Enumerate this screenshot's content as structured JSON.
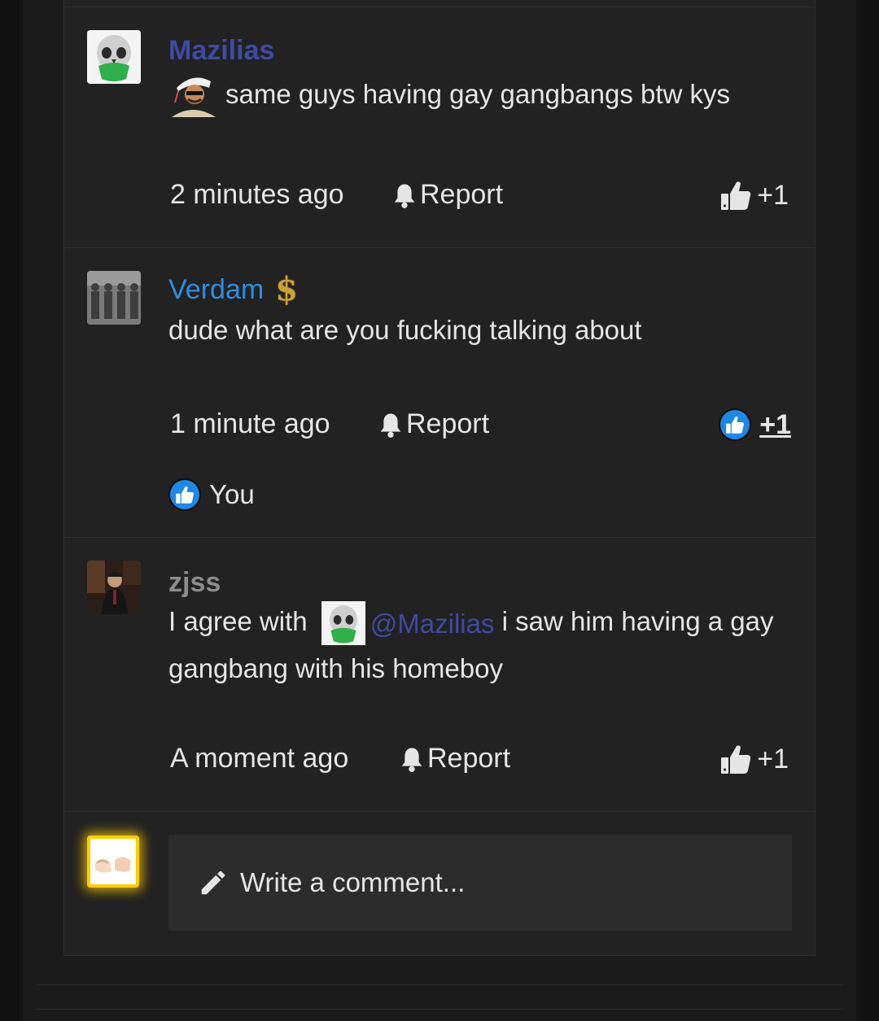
{
  "colors": {
    "accent_purple": "#3f4aa0",
    "accent_blue": "#2b8fe0",
    "muted_user": "#8c8c8c",
    "like_blue": "#1e88e5",
    "gold": "#c9a23a",
    "avatar_glow": "#ffcc00"
  },
  "comments": [
    {
      "username": "Mazilias",
      "text": "same guys having gay gangbangs btw kys",
      "time": "2 minutes ago",
      "report_label": "Report",
      "likes": "+1",
      "liked": false
    },
    {
      "username": "Verdam",
      "badge_icon": "dollar-sign-icon",
      "text": "dude what are you fucking talking about",
      "time": "1 minute ago",
      "report_label": "Report",
      "likes": "+1",
      "liked": true,
      "likers": [
        "You"
      ]
    },
    {
      "username": "zjss",
      "text_before": "I agree with",
      "mention": "@Mazilias",
      "text_after": "i saw him having a gay gangbang with his homeboy",
      "time": "A moment ago",
      "report_label": "Report",
      "likes": "+1",
      "liked": false
    }
  ],
  "composer": {
    "placeholder": "Write a comment..."
  }
}
